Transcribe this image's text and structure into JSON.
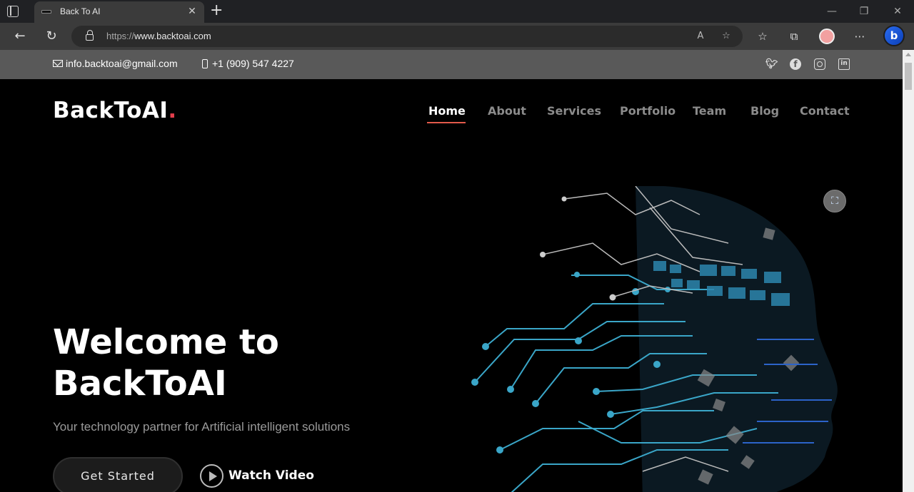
{
  "browser": {
    "tab_title": "Back To AI",
    "url_scheme": "https://",
    "url_host": "www.backtoai.com",
    "tab_close": "✕",
    "new_tab": "+"
  },
  "topbar": {
    "email": "info.backtoai@gmail.com",
    "phone": "+1 (909) 547 4227",
    "social": [
      "twitter-icon",
      "facebook-icon",
      "instagram-icon",
      "linkedin-icon"
    ]
  },
  "header": {
    "logo": "BackToAI",
    "logo_dot": ".",
    "nav": [
      "Home",
      "About",
      "Services",
      "Portfolio",
      "Team",
      "Blog",
      "Contact"
    ],
    "active_nav": "Home"
  },
  "hero": {
    "title_line1": "Welcome to",
    "title_line2": "BackToAI",
    "subtitle": "Your technology partner for Artificial intelligent solutions",
    "cta_primary": "Get Started",
    "cta_secondary": "Watch Video"
  },
  "colors": {
    "accent": "#e33e4c",
    "topbar_bg": "#595959",
    "page_bg": "#000000",
    "circuit": "#3aa6c8"
  }
}
